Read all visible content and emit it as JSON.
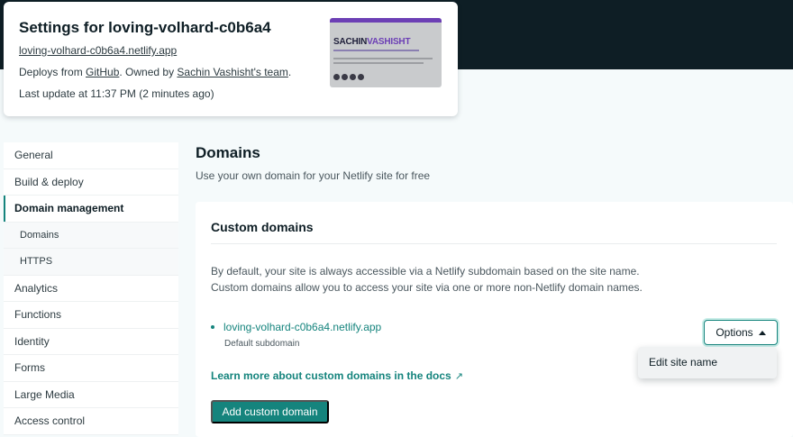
{
  "site": {
    "title": "Settings for loving-volhard-c0b6a4",
    "url": "loving-volhard-c0b6a4.netlify.app",
    "deploys_prefix": "Deploys from ",
    "deploys_source": "GitHub",
    "owned_prefix": ". Owned by ",
    "owner": "Sachin Vashisht's team",
    "owned_suffix": ".",
    "last_update": "Last update at 11:37 PM (2 minutes ago)",
    "thumbnail_name_a": "SACHIN",
    "thumbnail_name_b": "VASHISHT"
  },
  "sidebar": {
    "items": [
      {
        "label": "General"
      },
      {
        "label": "Build & deploy"
      },
      {
        "label": "Domain management"
      },
      {
        "label": "Domains"
      },
      {
        "label": "HTTPS"
      },
      {
        "label": "Analytics"
      },
      {
        "label": "Functions"
      },
      {
        "label": "Identity"
      },
      {
        "label": "Forms"
      },
      {
        "label": "Large Media"
      },
      {
        "label": "Access control"
      }
    ]
  },
  "main": {
    "heading": "Domains",
    "subheading": "Use your own domain for your Netlify site for free",
    "panel": {
      "title": "Custom domains",
      "desc_line1": "By default, your site is always accessible via a Netlify subdomain based on the site name.",
      "desc_line2": "Custom domains allow you to access your site via one or more non-Netlify domain names.",
      "domain": "loving-volhard-c0b6a4.netlify.app",
      "domain_caption": "Default subdomain",
      "options_label": "Options",
      "dropdown_item": "Edit site name",
      "learn_more": "Learn more about custom domains in the docs",
      "learn_more_icon": "↗",
      "add_button": "Add custom domain"
    }
  },
  "colors": {
    "accent": "#15847d",
    "header_band": "#0e1e25",
    "background": "#f5fafb"
  }
}
